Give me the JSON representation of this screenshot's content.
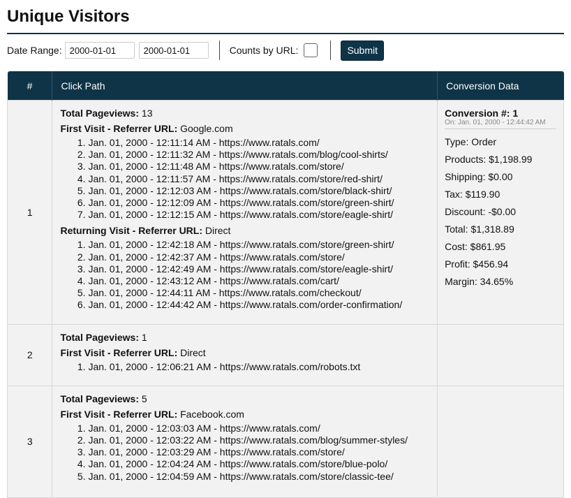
{
  "page": {
    "title": "Unique Visitors"
  },
  "filters": {
    "date_range_label": "Date Range:",
    "start_date": "2000-01-01",
    "end_date": "2000-01-01",
    "counts_by_url_label": "Counts by URL:",
    "counts_by_url_checked": false,
    "submit_label": "Submit"
  },
  "table": {
    "headers": {
      "num": "#",
      "path": "Click Path",
      "conversion": "Conversion Data"
    },
    "rows": [
      {
        "num": "1",
        "total_pageviews_label": "Total Pageviews:",
        "total_pageviews": "13",
        "visits": [
          {
            "label": "First Visit - Referrer URL:",
            "referrer": "Google.com",
            "pages": [
              "Jan. 01, 2000 - 12:11:14 AM - https://www.ratals.com/",
              "Jan. 01, 2000 - 12:11:32 AM - https://www.ratals.com/blog/cool-shirts/",
              "Jan. 01, 2000 - 12:11:48 AM - https://www.ratals.com/store/",
              "Jan. 01, 2000 - 12:11:57 AM - https://www.ratals.com/store/red-shirt/",
              "Jan. 01, 2000 - 12:12:03 AM - https://www.ratals.com/store/black-shirt/",
              "Jan. 01, 2000 - 12:12:09 AM - https://www.ratals.com/store/green-shirt/",
              "Jan. 01, 2000 - 12:12:15 AM - https://www.ratals.com/store/eagle-shirt/"
            ]
          },
          {
            "label": "Returning Visit - Referrer URL:",
            "referrer": "Direct",
            "pages": [
              "Jan. 01, 2000 - 12:42:18 AM - https://www.ratals.com/store/green-shirt/",
              "Jan. 01, 2000 - 12:42:37 AM - https://www.ratals.com/store/",
              "Jan. 01, 2000 - 12:42:49 AM - https://www.ratals.com/store/eagle-shirt/",
              "Jan. 01, 2000 - 12:43:12 AM - https://www.ratals.com/cart/",
              "Jan. 01, 2000 - 12:44:11 AM - https://www.ratals.com/checkout/",
              "Jan. 01, 2000 - 12:44:42 AM - https://www.ratals.com/order-confirmation/"
            ]
          }
        ],
        "conversion": {
          "title": "Conversion #: 1",
          "date": "On: Jan. 01, 2000 - 12:44:42 AM",
          "lines": [
            "Type: Order",
            "Products: $1,198.99",
            "Shipping: $0.00",
            "Tax: $119.90",
            "Discount: -$0.00",
            "Total: $1,318.89",
            "Cost: $861.95",
            "Profit: $456.94",
            "Margin: 34.65%"
          ]
        }
      },
      {
        "num": "2",
        "total_pageviews_label": "Total Pageviews:",
        "total_pageviews": "1",
        "visits": [
          {
            "label": "First Visit - Referrer URL:",
            "referrer": "Direct",
            "pages": [
              "Jan. 01, 2000 - 12:06:21 AM - https://www.ratals.com/robots.txt"
            ]
          }
        ],
        "conversion": null
      },
      {
        "num": "3",
        "total_pageviews_label": "Total Pageviews:",
        "total_pageviews": "5",
        "visits": [
          {
            "label": "First Visit - Referrer URL:",
            "referrer": "Facebook.com",
            "pages": [
              "Jan. 01, 2000 - 12:03:03 AM - https://www.ratals.com/",
              "Jan. 01, 2000 - 12:03:22 AM - https://www.ratals.com/blog/summer-styles/",
              "Jan. 01, 2000 - 12:03:29 AM - https://www.ratals.com/store/",
              "Jan. 01, 2000 - 12:04:24 AM - https://www.ratals.com/store/blue-polo/",
              "Jan. 01, 2000 - 12:04:59 AM - https://www.ratals.com/store/classic-tee/"
            ]
          }
        ],
        "conversion": null
      }
    ]
  }
}
